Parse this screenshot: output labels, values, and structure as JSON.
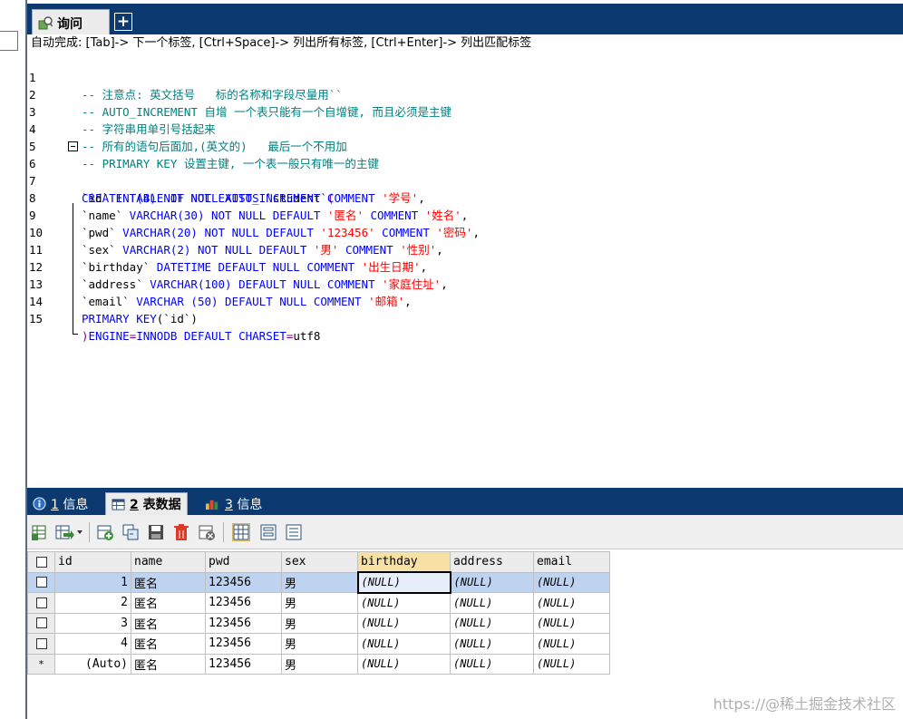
{
  "top_tabs": {
    "query_label": "询问",
    "add_label": "+"
  },
  "hint": "自动完成: [Tab]-> 下一个标签, [Ctrl+Space]-> 列出所有标签, [Ctrl+Enter]-> 列出匹配标签",
  "line_numbers": [
    "1",
    "2",
    "3",
    "4",
    "5",
    "6",
    "7",
    "8",
    "9",
    "10",
    "11",
    "12",
    "13",
    "14",
    "15"
  ],
  "code": {
    "l1": "-- 注意点: 英文括号   标的名称和字段尽量用``",
    "l2": "-- AUTO_INCREMENT 自增 一个表只能有一个自增键, 而且必须是主键",
    "l3": "-- 字符串用单引号括起来",
    "l4": "-- 所有的语句后面加,(英文的)   最后一个不用加",
    "l5": "-- PRIMARY KEY 设置主键, 一个表一般只有唯一的主键",
    "l6": {
      "kw": "CREATE TABLE IF NOT EXISTS",
      "name": " `student`",
      "paren": "("
    },
    "l7": {
      "col": "`id`",
      "kw1": " INT(4) NOT NULL AUTO_INCREMENT COMMENT ",
      "str": "'学号'",
      "end": ","
    },
    "l8": {
      "col": "`name`",
      "kw1": " VARCHAR(30) NOT NULL DEFAULT ",
      "str1": "'匿名'",
      "kw2": " COMMENT ",
      "str2": "'姓名'",
      "end": ","
    },
    "l9": {
      "col": "`pwd`",
      "kw1": " VARCHAR(20) NOT NULL DEFAULT ",
      "str1": "'123456'",
      "kw2": " COMMENT ",
      "str2": "'密码'",
      "end": ","
    },
    "l10": {
      "col": "`sex`",
      "kw1": " VARCHAR(2) NOT NULL DEFAULT ",
      "str1": "'男'",
      "kw2": " COMMENT ",
      "str2": "'性别'",
      "end": ","
    },
    "l11": {
      "col": "`birthday`",
      "kw1": " DATETIME DEFAULT NULL COMMENT ",
      "str": "'出生日期'",
      "end": ","
    },
    "l12": {
      "col": "`address`",
      "kw1": " VARCHAR(100) DEFAULT NULL COMMENT ",
      "str": "'家庭住址'",
      "end": ","
    },
    "l13": {
      "col": "`email`",
      "kw1": " VARCHAR (50) DEFAULT NULL COMMENT ",
      "str": "'邮箱'",
      "end": ","
    },
    "l14": {
      "kw": "PRIMARY KEY",
      "rest": "(`id`)"
    },
    "l15": {
      "paren": ")",
      "kw1": "ENGINE",
      "eq1": "=",
      "kw2": "INNODB DEFAULT CHARSET",
      "eq2": "=",
      "val": "utf8"
    }
  },
  "bottom_tabs": [
    {
      "num": "1",
      "label": " 信息"
    },
    {
      "num": "2",
      "label": " 表数据"
    },
    {
      "num": "3",
      "label": " 信息"
    }
  ],
  "grid": {
    "columns": [
      "id",
      "name",
      "pwd",
      "sex",
      "birthday",
      "address",
      "email"
    ],
    "rows": [
      [
        "1",
        "匿名",
        "123456",
        "男",
        "(NULL)",
        "(NULL)",
        "(NULL)"
      ],
      [
        "2",
        "匿名",
        "123456",
        "男",
        "(NULL)",
        "(NULL)",
        "(NULL)"
      ],
      [
        "3",
        "匿名",
        "123456",
        "男",
        "(NULL)",
        "(NULL)",
        "(NULL)"
      ],
      [
        "4",
        "匿名",
        "123456",
        "男",
        "(NULL)",
        "(NULL)",
        "(NULL)"
      ]
    ],
    "auto_row": {
      "marker": "*",
      "id": "(Auto)",
      "name": "匿名",
      "pwd": "123456",
      "sex": "男",
      "birthday": "(NULL)",
      "address": "(NULL)",
      "email": "(NULL)"
    }
  },
  "watermark": "https://@稀土掘金技术社区",
  "colors": {
    "chrome": "#0c3a70",
    "comment": "#008080",
    "keyword": "#0000ff",
    "string": "#ff0000",
    "selected_row": "#bdd3f0",
    "selected_header": "#f7e0a3"
  }
}
